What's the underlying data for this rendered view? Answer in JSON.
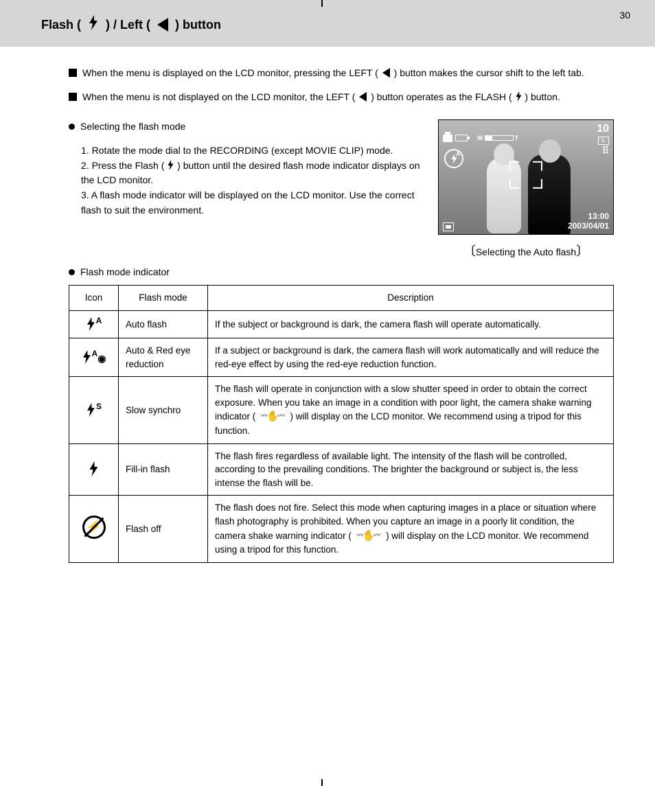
{
  "page_number": "30",
  "header": {
    "prefix": "Flash (",
    "mid": ") / Left (",
    "suffix": ") button"
  },
  "intro": {
    "line1a": "When the menu is displayed on the LCD monitor, pressing the LEFT (",
    "line1b": ") button makes the cursor shift to the left tab.",
    "line2a": "When the menu is not displayed on the LCD monitor, the LEFT (",
    "line2b": ") button operates as the FLASH (",
    "line2c": ") button."
  },
  "selecting": {
    "heading": "Selecting the flash mode",
    "step1": "1. Rotate the mode dial to the RECORDING (except MOVIE CLIP) mode.",
    "step2a": "2. Press the Flash (",
    "step2b": ") button until the desired flash mode indicator displays on the LCD monitor.",
    "step3": "3. A flash mode indicator will be displayed on the LCD monitor. Use the correct flash to suit the environment."
  },
  "lcd": {
    "shots": "10",
    "quality": "L",
    "time": "13:00",
    "date": "2003/04/01",
    "zoom_w": "W",
    "zoom_t": "T",
    "caption": "Selecting the Auto flash"
  },
  "table": {
    "heading": "Flash mode indicator",
    "headers": {
      "icon": "Icon",
      "mode": "Flash mode",
      "desc": "Description"
    },
    "rows": [
      {
        "mode": "Auto flash",
        "desc": "If the subject or background is dark, the camera flash will operate automatically."
      },
      {
        "mode": "Auto & Red eye reduction",
        "desc": "If a subject or background is dark, the camera flash will work automatically and will reduce the red-eye effect by using the red-eye reduction function."
      },
      {
        "mode": "Slow synchro",
        "desc_a": "The flash will operate in conjunction with a slow shutter speed in order to obtain the correct exposure. When you take an image in a condition with poor light, the camera shake warning indicator (",
        "desc_b": ") will display on the LCD monitor. We recommend using a tripod for this function."
      },
      {
        "mode": "Fill-in flash",
        "desc": "The flash fires regardless of available light. The intensity of the flash will be controlled, according to the prevailing conditions. The brighter the background or subject is, the less intense the flash will be."
      },
      {
        "mode": "Flash off",
        "desc_a": "The flash does not fire. Select this mode when capturing images in a place or situation where flash photography is prohibited. When you capture an image in a poorly lit condition, the camera shake warning indicator (",
        "desc_b": ") will display on the LCD monitor. We recommend using a tripod for this function."
      }
    ]
  }
}
